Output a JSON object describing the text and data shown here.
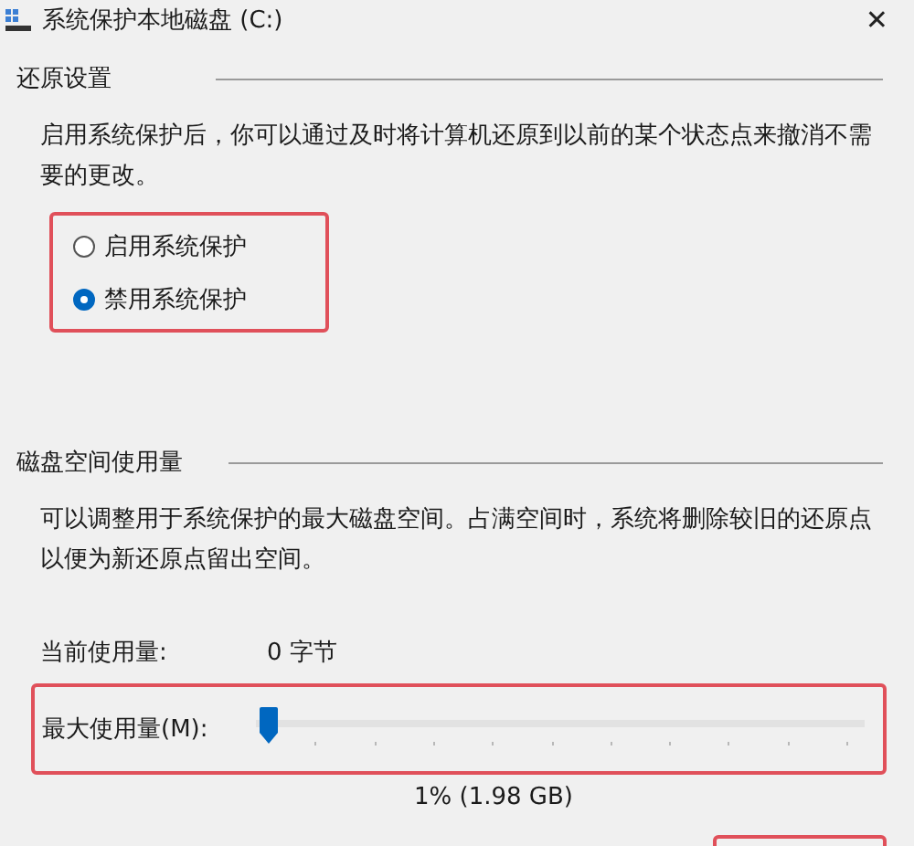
{
  "window": {
    "title": "系统保护本地磁盘 (C:)",
    "close": "✕"
  },
  "restore_settings": {
    "heading": "还原设置",
    "description": "启用系统保护后，你可以通过及时将计算机还原到以前的某个状态点来撤消不需要的更改。",
    "options": [
      {
        "label": "启用系统保护",
        "selected": false
      },
      {
        "label": "禁用系统保护",
        "selected": true
      }
    ]
  },
  "disk_usage": {
    "heading": "磁盘空间使用量",
    "description": "可以调整用于系统保护的最大磁盘空间。占满空间时，系统将删除较旧的还原点以便为新还原点留出空间。",
    "current_label": "当前使用量:",
    "current_value": "0 字节",
    "max_label": "最大使用量(M):",
    "max_slider": {
      "level": 0.02
    },
    "max_reading": "1% (1.98 GB)"
  }
}
